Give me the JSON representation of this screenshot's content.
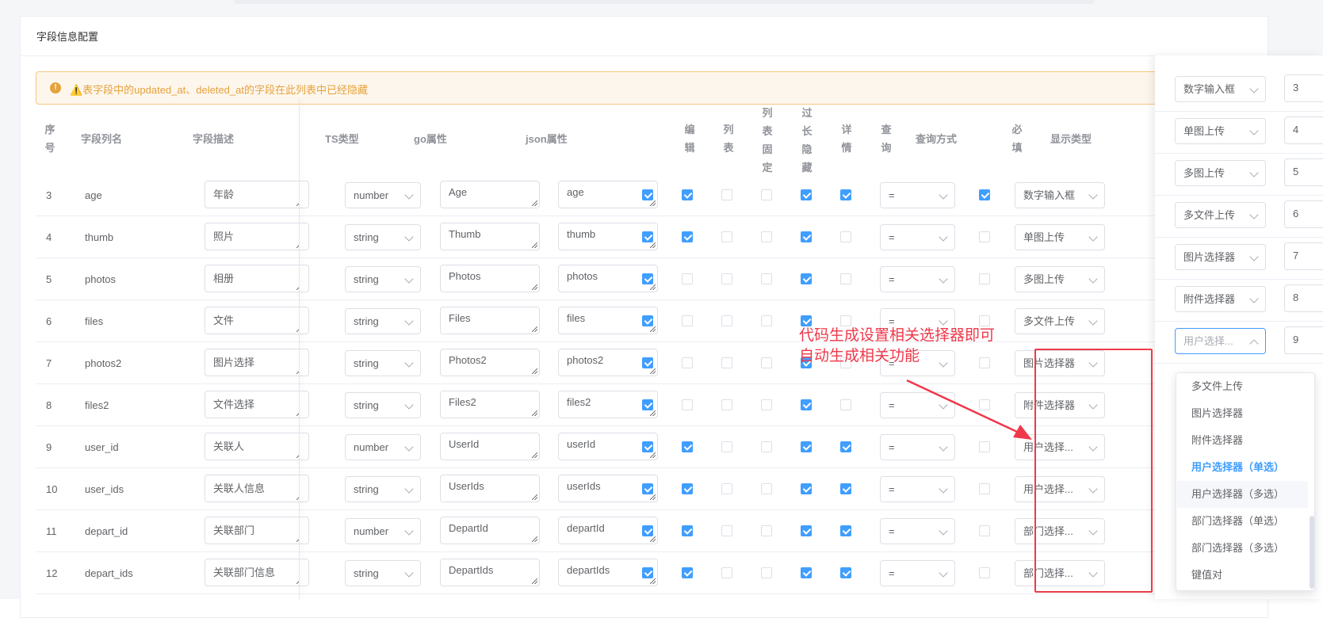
{
  "card": {
    "title": "字段信息配置"
  },
  "alert": {
    "icon": "!",
    "text": "⚠️表字段中的updated_at、deleted_at的字段在此列表中已经隐藏"
  },
  "headers": {
    "seq": "序号",
    "column": "字段列名",
    "desc": "字段描述",
    "ts": "TS类型",
    "go": "go属性",
    "json": "json属性",
    "edit": "编辑",
    "list": "列表",
    "fixed": "列表固定",
    "hide": "过长隐藏",
    "detail": "详情",
    "query": "查询",
    "query_mode": "查询方式",
    "required": "必填",
    "display": "显示类型"
  },
  "rows": [
    {
      "seq": "3",
      "column": "age",
      "desc": "年龄",
      "ts": "number",
      "go": "Age",
      "json": "age",
      "edit": true,
      "list": true,
      "fixed": false,
      "hide": false,
      "detail": true,
      "query": true,
      "query_mode": "=",
      "required": true,
      "display": "数字输入框"
    },
    {
      "seq": "4",
      "column": "thumb",
      "desc": "照片",
      "ts": "string",
      "go": "Thumb",
      "json": "thumb",
      "edit": true,
      "list": true,
      "fixed": false,
      "hide": false,
      "detail": true,
      "query": false,
      "query_mode": "=",
      "required": false,
      "display": "单图上传"
    },
    {
      "seq": "5",
      "column": "photos",
      "desc": "相册",
      "ts": "string",
      "go": "Photos",
      "json": "photos",
      "edit": true,
      "list": false,
      "fixed": false,
      "hide": false,
      "detail": true,
      "query": false,
      "query_mode": "=",
      "required": false,
      "display": "多图上传"
    },
    {
      "seq": "6",
      "column": "files",
      "desc": "文件",
      "ts": "string",
      "go": "Files",
      "json": "files",
      "edit": true,
      "list": false,
      "fixed": false,
      "hide": false,
      "detail": true,
      "query": false,
      "query_mode": "=",
      "required": false,
      "display": "多文件上传"
    },
    {
      "seq": "7",
      "column": "photos2",
      "desc": "图片选择",
      "ts": "string",
      "go": "Photos2",
      "json": "photos2",
      "edit": true,
      "list": false,
      "fixed": false,
      "hide": false,
      "detail": true,
      "query": false,
      "query_mode": "=",
      "required": false,
      "display": "图片选择器"
    },
    {
      "seq": "8",
      "column": "files2",
      "desc": "文件选择",
      "ts": "string",
      "go": "Files2",
      "json": "files2",
      "edit": true,
      "list": false,
      "fixed": false,
      "hide": false,
      "detail": true,
      "query": false,
      "query_mode": "=",
      "required": false,
      "display": "附件选择器"
    },
    {
      "seq": "9",
      "column": "user_id",
      "desc": "关联人",
      "ts": "number",
      "go": "UserId",
      "json": "userId",
      "edit": true,
      "list": true,
      "fixed": false,
      "hide": false,
      "detail": true,
      "query": true,
      "query_mode": "=",
      "required": false,
      "display": "用户选择..."
    },
    {
      "seq": "10",
      "column": "user_ids",
      "desc": "关联人信息",
      "ts": "string",
      "go": "UserIds",
      "json": "userIds",
      "edit": true,
      "list": true,
      "fixed": false,
      "hide": false,
      "detail": true,
      "query": true,
      "query_mode": "=",
      "required": false,
      "display": "用户选择..."
    },
    {
      "seq": "11",
      "column": "depart_id",
      "desc": "关联部门",
      "ts": "number",
      "go": "DepartId",
      "json": "departId",
      "edit": true,
      "list": true,
      "fixed": false,
      "hide": false,
      "detail": true,
      "query": true,
      "query_mode": "=",
      "required": false,
      "display": "部门选择..."
    },
    {
      "seq": "12",
      "column": "depart_ids",
      "desc": "关联部门信息",
      "ts": "string",
      "go": "DepartIds",
      "json": "departIds",
      "edit": true,
      "list": true,
      "fixed": false,
      "hide": false,
      "detail": true,
      "query": true,
      "query_mode": "=",
      "required": false,
      "display": "部门选择..."
    }
  ],
  "right_panel": {
    "rows": [
      {
        "display": "数字输入框",
        "sort": "3"
      },
      {
        "display": "单图上传",
        "sort": "4"
      },
      {
        "display": "多图上传",
        "sort": "5"
      },
      {
        "display": "多文件上传",
        "sort": "6"
      },
      {
        "display": "图片选择器",
        "sort": "7"
      },
      {
        "display": "附件选择器",
        "sort": "8"
      },
      {
        "display": "用户选择...",
        "sort": "9"
      }
    ]
  },
  "dropdown": {
    "items": [
      "多文件上传",
      "图片选择器",
      "附件选择器",
      "用户选择器（单选）",
      "用户选择器（多选）",
      "部门选择器（单选）",
      "部门选择器（多选）",
      "键值对"
    ],
    "selected_index": 3,
    "hover_index": 4
  },
  "annotation": {
    "line1": "代码生成设置相关选择器即可",
    "line2": "自动生成相关功能",
    "color": "#f0384a"
  },
  "colors": {
    "primary": "#409eff",
    "warning": "#e6a23c"
  }
}
